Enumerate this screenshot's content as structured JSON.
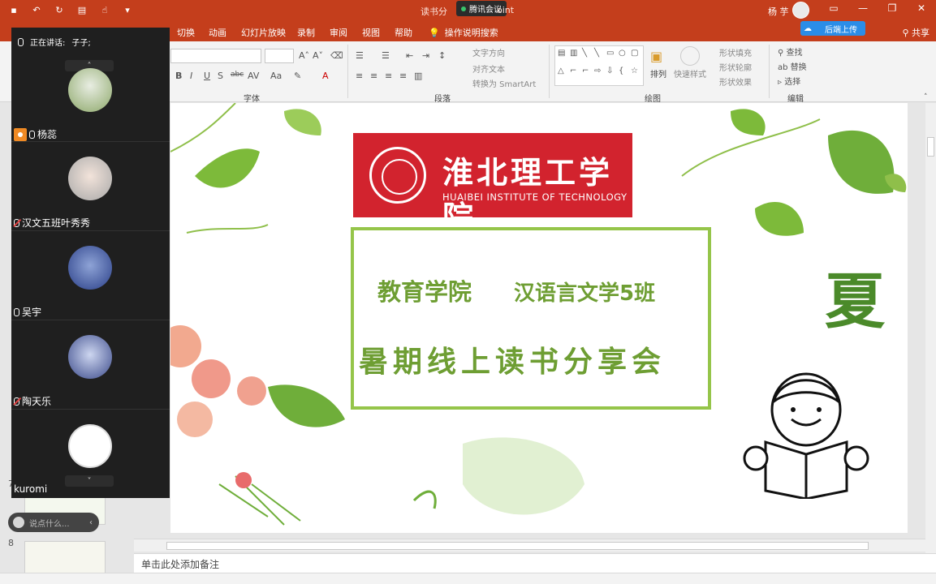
{
  "titlebar": {
    "doc_title": "读书分",
    "doc_title_tail": "oint",
    "meeting_label": "腾讯会议",
    "user_name": "杨 芋"
  },
  "tabs": [
    "切换",
    "动画",
    "幻灯片放映",
    "录制",
    "审阅",
    "视图",
    "帮助"
  ],
  "tellme": "操作说明搜索",
  "share": "共享",
  "cloud": "后端上传",
  "ribbon": {
    "groups": {
      "font": "字体",
      "paragraph": "段落",
      "drawing": "绘图",
      "editing": "编辑"
    },
    "font_buttons": [
      "B",
      "I",
      "U",
      "S",
      "abc",
      "AV",
      "Aa",
      "A"
    ],
    "paragraph_items": [
      "文字方向",
      "对齐文本",
      "转换为 SmartArt"
    ],
    "drawing": {
      "arrange": "排列",
      "quick_styles": "快速样式",
      "fill": "形状填充",
      "outline": "形状轮廓",
      "effects": "形状效果"
    },
    "editing": {
      "find": "查找",
      "replace": "替换",
      "select": "选择"
    }
  },
  "meeting": {
    "speaking_label": "正在讲话:",
    "speaking_name": "子子;",
    "participants": [
      {
        "name": "杨蕊",
        "host": true
      },
      {
        "name": "汉文五班叶秀秀",
        "host": false
      },
      {
        "name": "吴宇",
        "host": false
      },
      {
        "name": "陶天乐",
        "host": false
      },
      {
        "name": "kuromi",
        "host": false
      }
    ],
    "chat_placeholder": "说点什么..."
  },
  "slide": {
    "logo_cn": "淮北理工学院",
    "logo_en": "HUAIBEI INSTITUTE OF TECHNOLOGY",
    "line1": "教育学院",
    "line1b": "汉语言文学5班",
    "line2": "暑期线上读书分享会",
    "season": "夏"
  },
  "thumbnails": [
    "7",
    "8"
  ],
  "notes": "单击此处添加备注"
}
